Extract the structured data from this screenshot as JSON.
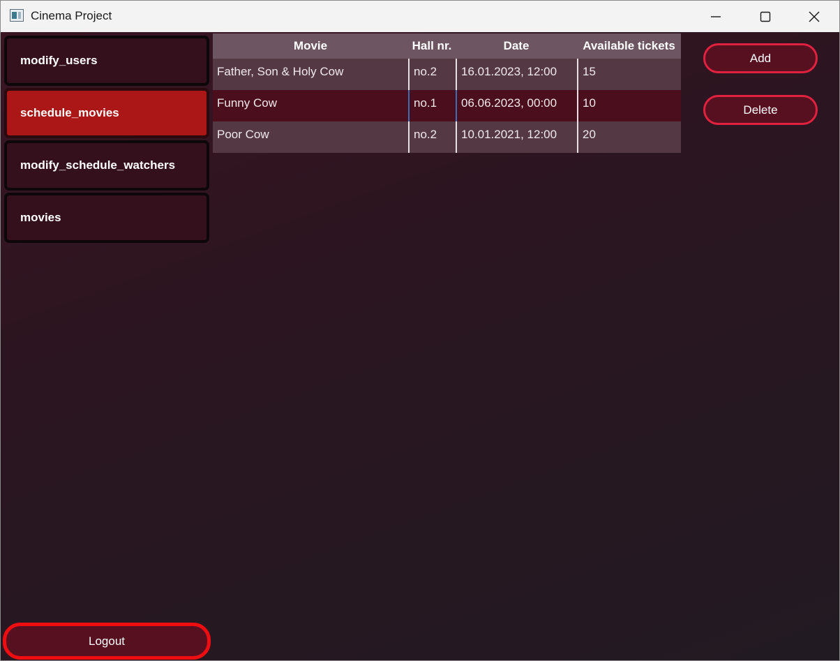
{
  "window": {
    "title": "Cinema Project"
  },
  "sidebar": {
    "items": [
      {
        "label": "modify_users",
        "active": false
      },
      {
        "label": "schedule_movies",
        "active": true
      },
      {
        "label": "modify_schedule_watchers",
        "active": false
      },
      {
        "label": "movies",
        "active": false
      }
    ],
    "logout_label": "Logout"
  },
  "table": {
    "headers": [
      "Movie",
      "Hall nr.",
      "Date",
      "Available tickets"
    ],
    "rows": [
      [
        "Father, Son & Holy Cow",
        "no.2",
        "16.01.2023, 12:00",
        "15"
      ],
      [
        "Funny Cow",
        "no.1",
        "06.06.2023, 00:00",
        "10"
      ],
      [
        "Poor Cow",
        "no.2",
        "10.01.2021, 12:00",
        "20"
      ]
    ]
  },
  "actions": {
    "add_label": "Add",
    "delete_label": "Delete"
  },
  "colors": {
    "active_nav": "#ab1616",
    "nav_bg": "#34101c",
    "accent_border": "#e0213f",
    "logout_border": "#ee0e12"
  }
}
